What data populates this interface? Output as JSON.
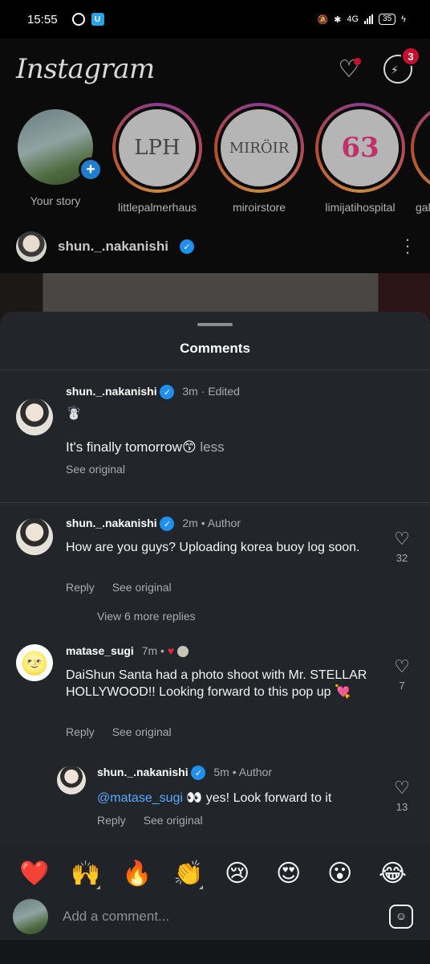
{
  "status_bar": {
    "time": "15:55",
    "badge_letter": "U",
    "network": "4G",
    "battery": "35"
  },
  "app": {
    "logo": "Instagram",
    "messages_badge": "3"
  },
  "stories": [
    {
      "name": "Your story",
      "own": true
    },
    {
      "name": "littlepalmerhaus",
      "mark": "LPH"
    },
    {
      "name": "miroirstore",
      "mark": "MIRÖIR"
    },
    {
      "name": "limijatihospital",
      "mark": "63"
    },
    {
      "name": "gal"
    }
  ],
  "post": {
    "username": "shun._.nakanishi"
  },
  "sheet": {
    "title": "Comments"
  },
  "caption": {
    "username": "shun._.nakanishi",
    "meta": "3m · Edited",
    "emoji_line": "☃️",
    "text": "It's finally tomorrow😙",
    "less": "less",
    "see_original": "See original"
  },
  "comments": [
    {
      "username": "shun._.nakanishi",
      "meta": "2m • Author",
      "text": "How are you guys? Uploading korea buoy log soon.",
      "reply": "Reply",
      "see_original": "See original",
      "likes": "32",
      "view_more": "View 6 more replies"
    },
    {
      "username": "matase_sugi",
      "meta": "7m •",
      "text": "DaiShun Santa had a photo shoot with Mr. STELLAR HOLLYWOOD!! Looking forward to this pop up 💘",
      "reply": "Reply",
      "see_original": "See original",
      "likes": "7"
    },
    {
      "username": "shun._.nakanishi",
      "meta": "5m • Author",
      "mention": "@matase_sugi",
      "text": " 👀 yes! Look forward to it",
      "reply": "Reply",
      "see_original": "See original",
      "likes": "13"
    }
  ],
  "reactions": [
    "❤️",
    "🙌",
    "🔥",
    "👏",
    "😢",
    "😍",
    "😮",
    "😂"
  ],
  "input": {
    "placeholder": "Add a comment..."
  }
}
